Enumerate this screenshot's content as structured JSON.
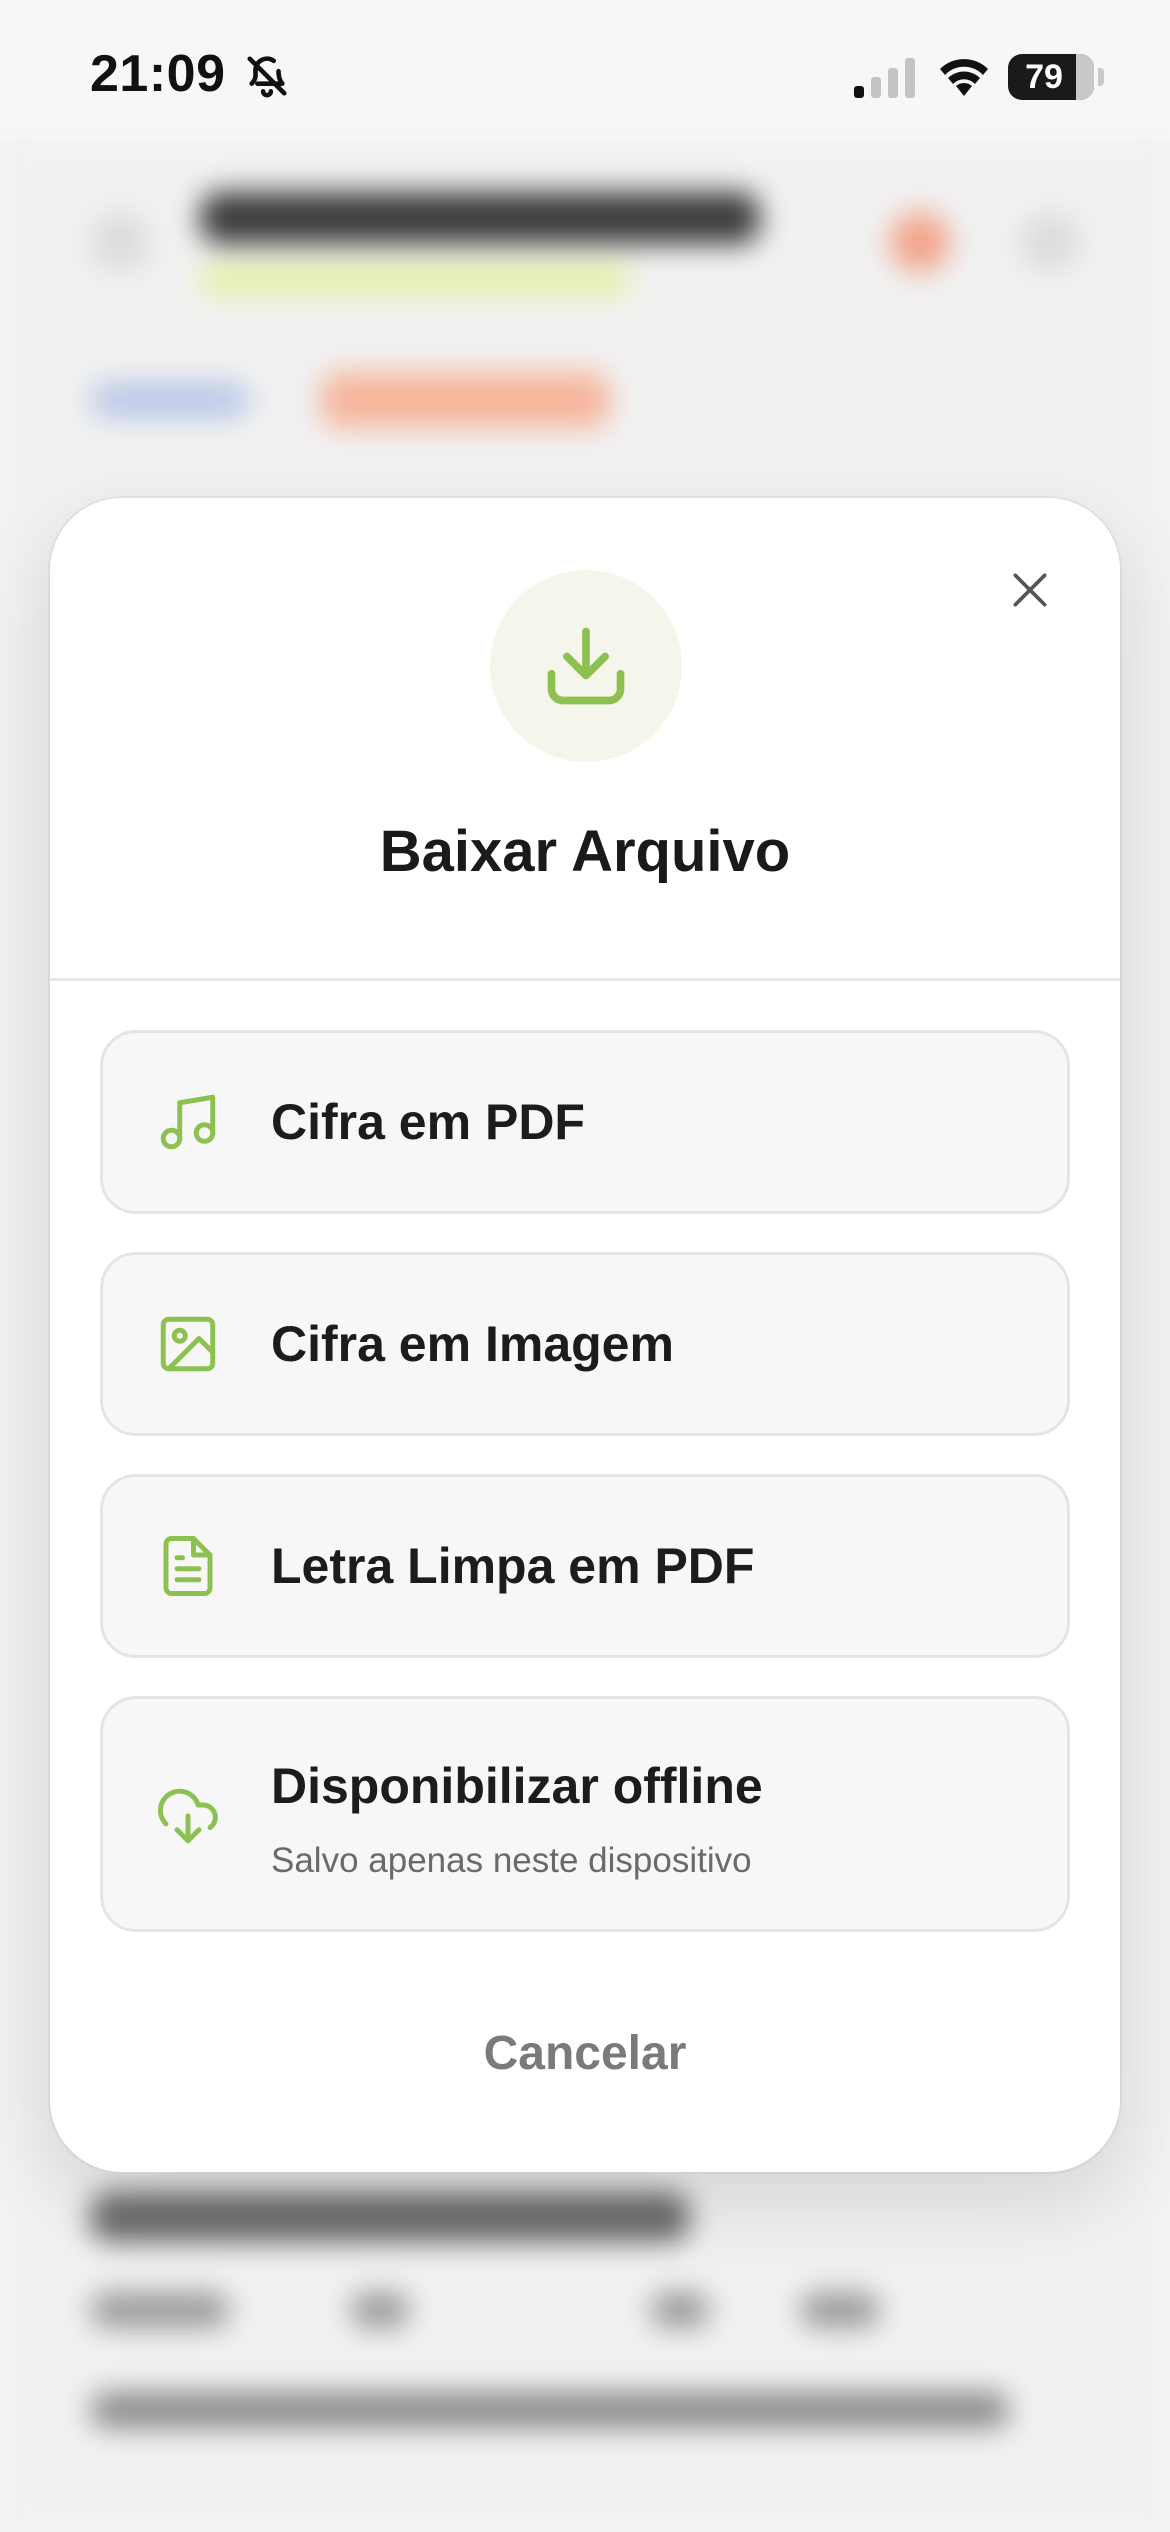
{
  "status_bar": {
    "time": "21:09",
    "battery": "79",
    "icons": [
      "bell-slash-icon",
      "cellular-signal-icon",
      "wifi-icon",
      "battery-icon"
    ]
  },
  "modal": {
    "header_icon": "download-icon",
    "title": "Baixar Arquivo",
    "close_icon": "close-icon",
    "options": [
      {
        "label": "Cifra em PDF",
        "icon": "music-note-icon"
      },
      {
        "label": "Cifra em Imagem",
        "icon": "image-icon"
      },
      {
        "label": "Letra Limpa em PDF",
        "icon": "document-icon"
      },
      {
        "label": "Disponibilizar offline",
        "sublabel": "Salvo apenas neste dispositivo",
        "icon": "cloud-download-icon"
      }
    ],
    "cancel_label": "Cancelar"
  },
  "colors": {
    "accent": "#8cc152",
    "icon_circle_bg": "#f5f5ec",
    "option_bg": "#f7f7f7",
    "cancel_text": "#7a7a7a"
  }
}
